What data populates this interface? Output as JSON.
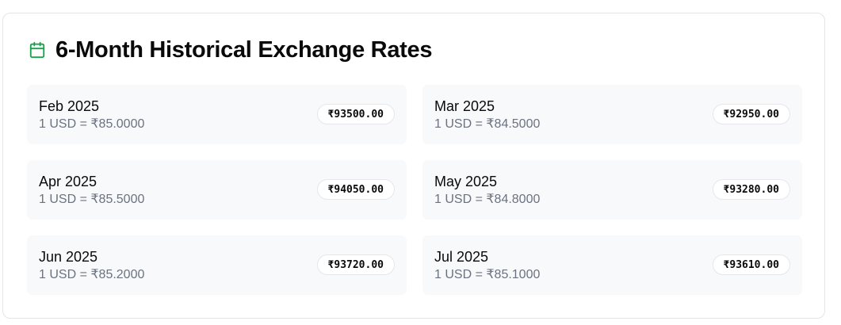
{
  "header": {
    "title": "6-Month Historical Exchange Rates",
    "icon": "calendar-icon",
    "icon_color": "#16a34a"
  },
  "rates": [
    {
      "month": "Feb 2025",
      "conversion": "1 USD = ₹85.0000",
      "amount": "₹93500.00"
    },
    {
      "month": "Mar 2025",
      "conversion": "1 USD = ₹84.5000",
      "amount": "₹92950.00"
    },
    {
      "month": "Apr 2025",
      "conversion": "1 USD = ₹85.5000",
      "amount": "₹94050.00"
    },
    {
      "month": "May 2025",
      "conversion": "1 USD = ₹84.8000",
      "amount": "₹93280.00"
    },
    {
      "month": "Jun 2025",
      "conversion": "1 USD = ₹85.2000",
      "amount": "₹93720.00"
    },
    {
      "month": "Jul 2025",
      "conversion": "1 USD = ₹85.1000",
      "amount": "₹93610.00"
    }
  ]
}
